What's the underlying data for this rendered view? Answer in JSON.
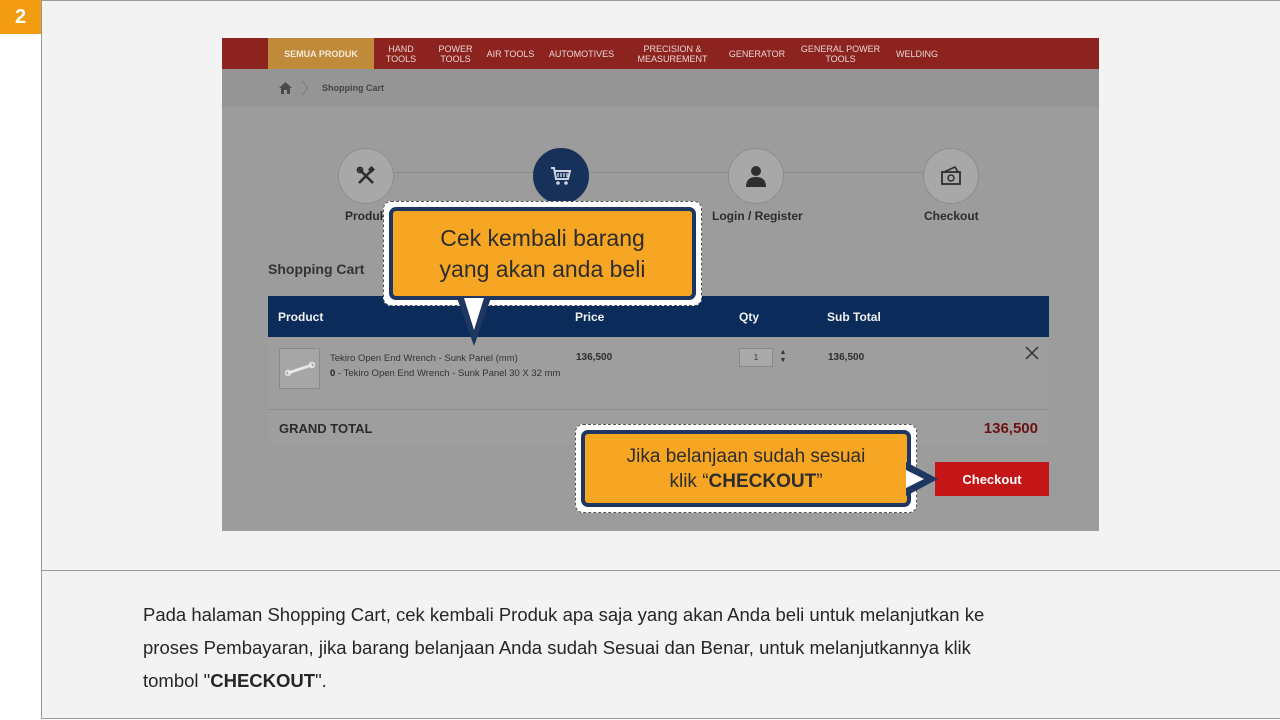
{
  "step_number": "2",
  "site": {
    "nav": [
      {
        "label": "SEMUA PRODUK",
        "active": true
      },
      {
        "label": "HAND TOOLS"
      },
      {
        "label": "POWER TOOLS"
      },
      {
        "label": "AIR TOOLS"
      },
      {
        "label": "AUTOMOTIVES"
      },
      {
        "label": "PRECISION & MEASUREMENT"
      },
      {
        "label": "GENERATOR"
      },
      {
        "label": "GENERAL POWER TOOLS"
      },
      {
        "label": "WELDING"
      }
    ],
    "breadcrumb": {
      "current": "Shopping Cart"
    },
    "steps": [
      {
        "label": "Produk",
        "icon": "tools-icon"
      },
      {
        "label": "",
        "icon": "cart-icon",
        "active": true
      },
      {
        "label": "Login / Register",
        "icon": "user-icon"
      },
      {
        "label": "Checkout",
        "icon": "payment-icon"
      }
    ],
    "cart": {
      "title": "Shopping Cart",
      "columns": {
        "product": "Product",
        "price": "Price",
        "qty": "Qty",
        "subtotal": "Sub Total"
      },
      "items": [
        {
          "name": "Tekiro Open End Wrench - Sunk Panel (mm)",
          "variant_qty": "0",
          "variant": " - Tekiro Open End Wrench - Sunk Panel 30 X 32 mm",
          "price": "136,500",
          "qty": "1",
          "subtotal": "136,500"
        }
      ],
      "grand_total_label": "GRAND TOTAL",
      "grand_total": "136,500",
      "checkout_label": "Checkout"
    }
  },
  "callouts": {
    "review": {
      "line1": "Cek kembali barang",
      "line2": "yang akan anda beli"
    },
    "checkout": {
      "line1": "Jika belanjaan sudah sesuai",
      "line2_prefix": "klik “",
      "line2_bold": "CHECKOUT",
      "line2_suffix": "”"
    }
  },
  "caption": {
    "part1": "Pada halaman Shopping Cart, cek kembali Produk apa saja yang akan Anda beli untuk melanjutkan ke proses Pembayaran, jika barang belanjaan Anda sudah Sesuai dan Benar, untuk melanjutkannya klik tombol \"",
    "bold": "CHECKOUT",
    "part2": "\"."
  },
  "colors": {
    "accent_orange": "#f39c12",
    "nav_red": "#8c231f",
    "navy": "#0b2c5b",
    "checkout_red": "#c41616",
    "callout_fill": "#f7a623"
  }
}
